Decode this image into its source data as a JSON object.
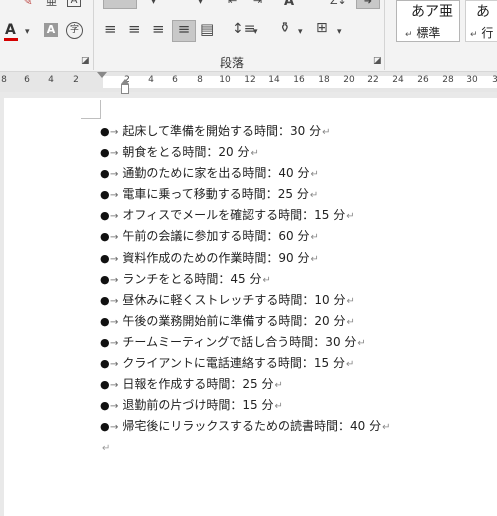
{
  "ribbon": {
    "paragraph_group_label": "段落",
    "style_normal_sample": "あア亜",
    "style_normal_name": "標準",
    "style_next_sample": "あ",
    "style_next_name": "行",
    "style_marker": "↵",
    "icon_A": "A",
    "icon_ji": "字"
  },
  "ruler": {
    "ticks": [
      "8",
      "6",
      "4",
      "2",
      "2",
      "4",
      "6",
      "8",
      "10",
      "12",
      "14",
      "16",
      "18",
      "20",
      "22",
      "24",
      "26",
      "28",
      "30",
      "3"
    ]
  },
  "document": {
    "list_items": [
      "起床して準備を開始する時間：30 分",
      "朝食をとる時間：20 分",
      "通勤のために家を出る時間：40 分",
      "電車に乗って移動する時間：25 分",
      "オフィスでメールを確認する時間：15 分",
      "午前の会議に参加する時間：60 分",
      "資料作成のための作業時間：90 分",
      "ランチをとる時間：45 分",
      "昼休みに軽くストレッチする時間：10 分",
      "午後の業務開始前に準備する時間：20 分",
      "チームミーティングで話し合う時間：30 分",
      "クライアントに電話連絡する時間：15 分",
      "日報を作成する時間：25 分",
      "退勤前の片づけ時間：15 分",
      "帰宅後にリラックスするための読書時間：40 分"
    ],
    "bullet": "●",
    "tab_mark": "→",
    "paragraph_mark": "↵"
  },
  "colors": {
    "font_color_bar": "#d40000",
    "accent": "#2b579a"
  }
}
